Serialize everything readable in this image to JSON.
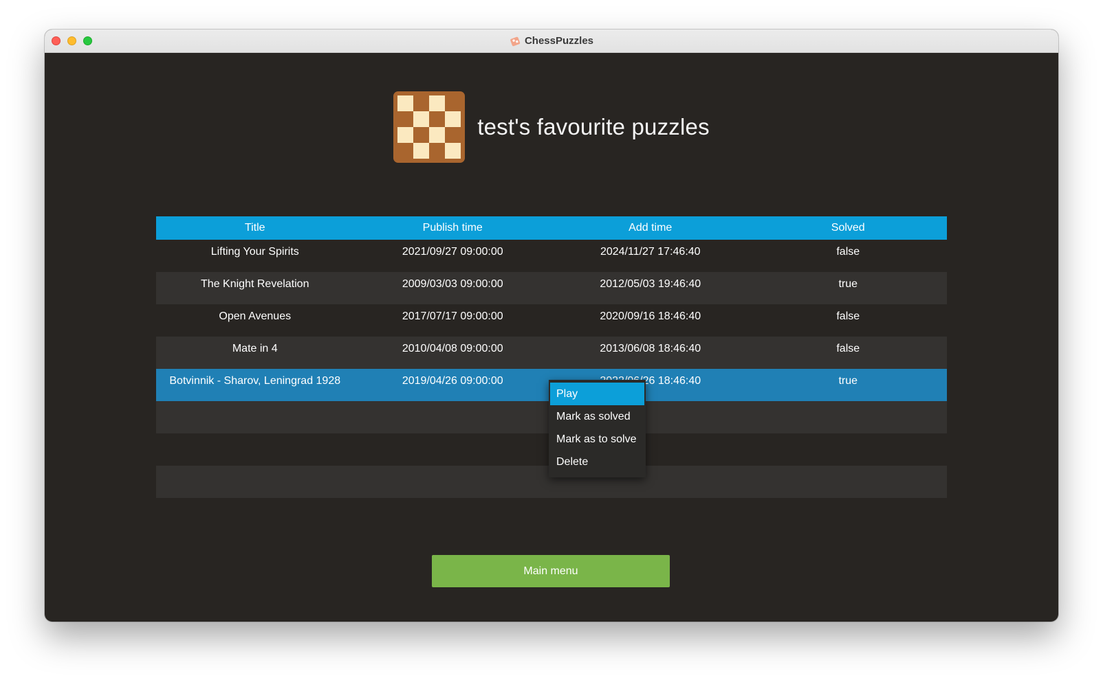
{
  "window": {
    "title": "ChessPuzzles",
    "app_icon": "chess-app-icon"
  },
  "header": {
    "title": "test's favourite puzzles",
    "icon": "chessboard-icon"
  },
  "table": {
    "columns": [
      "Title",
      "Publish time",
      "Add time",
      "Solved"
    ],
    "rows": [
      {
        "title": "Lifting Your Spirits",
        "publish": "2021/09/27 09:00:00",
        "added": "2024/11/27 17:46:40",
        "solved": "false"
      },
      {
        "title": "The Knight Revelation",
        "publish": "2009/03/03 09:00:00",
        "added": "2012/05/03 19:46:40",
        "solved": "true"
      },
      {
        "title": "Open Avenues",
        "publish": "2017/07/17 09:00:00",
        "added": "2020/09/16 18:46:40",
        "solved": "false"
      },
      {
        "title": "Mate in 4",
        "publish": "2010/04/08 09:00:00",
        "added": "2013/06/08 18:46:40",
        "solved": "false"
      },
      {
        "title": "Botvinnik - Sharov, Leningrad 1928",
        "publish": "2019/04/26 09:00:00",
        "added": "2022/06/26 18:46:40",
        "solved": "true"
      },
      {
        "title": "",
        "publish": "",
        "added": "",
        "solved": ""
      },
      {
        "title": "",
        "publish": "",
        "added": "",
        "solved": ""
      },
      {
        "title": "",
        "publish": "",
        "added": "",
        "solved": ""
      }
    ],
    "selected_row": 4
  },
  "context_menu": {
    "items": [
      "Play",
      "Mark as solved",
      "Mark as to solve",
      "Delete"
    ],
    "active": 0
  },
  "footer": {
    "main_menu_label": "Main menu"
  },
  "colors": {
    "background": "#282522",
    "header_blue": "#0c9fd9",
    "selected_row": "#2080b5",
    "button_green": "#7ab549",
    "board_dark": "#a9652e",
    "board_light": "#fbe9c0"
  }
}
